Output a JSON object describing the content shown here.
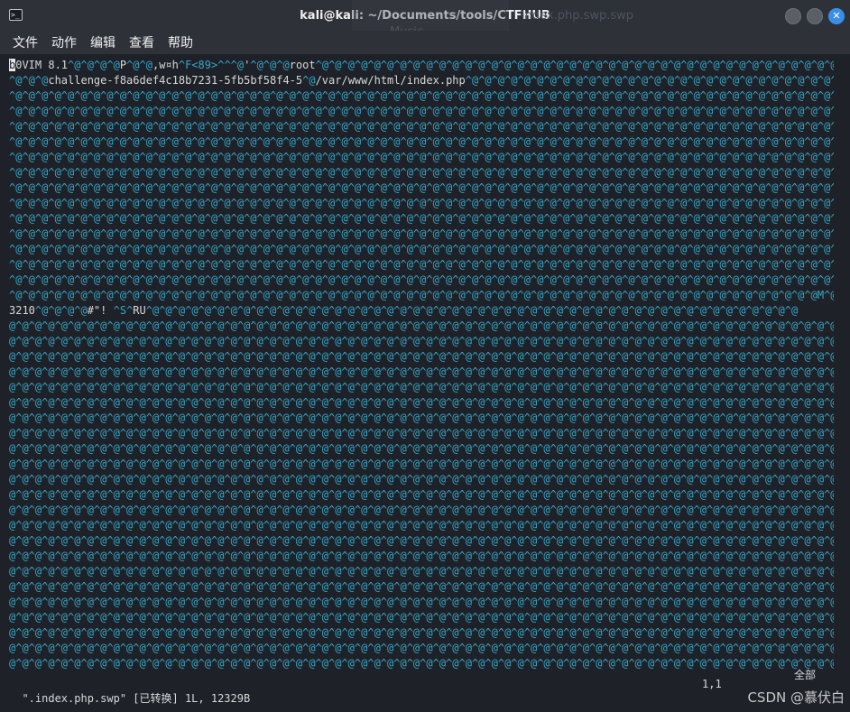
{
  "window": {
    "title": "kali@kali: ~/Documents/tools/CTFHUB",
    "terminal_icon_glyph": ">_",
    "close_glyph": "✕",
    "ghost_texts": [
      "index.php.swp.swp",
      "Music"
    ]
  },
  "menu": [
    "文件",
    "动作",
    "编辑",
    "查看",
    "帮助"
  ],
  "buffer": {
    "line1": {
      "cursor_char": "b",
      "segments": [
        {
          "t": "0VIM 8.1",
          "c": "w"
        },
        {
          "t": "^@^@^@^@",
          "c": "b"
        },
        {
          "t": "P",
          "c": "w"
        },
        {
          "t": "^@^@",
          "c": "b"
        },
        {
          "t": ",w¤h",
          "c": "w"
        },
        {
          "t": "^F<89>^^^@",
          "c": "b"
        },
        {
          "t": "'",
          "c": "w"
        },
        {
          "t": "^@^@^@",
          "c": "b"
        },
        {
          "t": "root",
          "c": "w"
        }
      ]
    },
    "line2": {
      "segments": [
        {
          "t": "^@^@^@",
          "c": "b"
        },
        {
          "t": "challenge-f8a6def4c18b7231-5fb5bf58f4-5",
          "c": "w"
        },
        {
          "t": "^@",
          "c": "b"
        },
        {
          "t": "/var/www/html/index.php",
          "c": "w"
        }
      ]
    },
    "line_b0": {
      "segments": [
        {
          "t": "^@^@^@^@^@^@^@^@^@^@^@^@^@^@^@^@^@^@^@^@^@^@^@^@^@^@^@^@^@^@^@^@^@^@^@^@^@^@^@^@^@^@^@^@^@^@^@^@^@^@^@^@^@^@^@^@^@^@^@^@^@^@",
          "c": "b"
        },
        {
          "t": "M",
          "c": "b"
        },
        {
          "t": "^@",
          "c": "b"
        }
      ]
    },
    "line_b1": {
      "segments": [
        {
          "t": "3210",
          "c": "w"
        },
        {
          "t": "^@^@^@^@",
          "c": "b"
        },
        {
          "t": "#\"!",
          "c": "w"
        },
        {
          "t": " ^S^",
          "c": "b"
        },
        {
          "t": "RU",
          "c": "w"
        },
        {
          "t": "^@^@^@^@^@^@^@^@^@^@^@^@^@^@^@^@^@^@^@^@^@^@^@^@^@^@^@^@^@^@^@^@^@^@^@^@^@^@^@^@^@^@^@^@^@^@^@^@^@^@",
          "c": "b"
        }
      ]
    },
    "fill_a": "^@^@^@^@^@^@^@^@^@^@^@^@^@^@^@^@^@^@^@^@^@^@^@^@^@^@^@^@^@^@^@^@^@^@^@^@^@^@^@^@^@^@^@^@^@^@^@^@^@^@^@^@^@^@^@^@^@^@^@^@^@^@^@^@^@^@^@^@^@^@",
    "fill_b": "@^@^@^@^@^@^@^@^@^@^@^@^@^@^@^@^@^@^@^@^@^@^@^@^@^@^@^@^@^@^@^@^@^@^@^@^@^@^@^@^@^@^@^@^@^@^@^@^@^@^@^@^@^@^@^@^@^@^@^@^@^@^@^@^@^@^@^@^@^@^"
  },
  "status": {
    "file_info": "\".index.php.swp\" [已转换] 1L, 12329B",
    "cursor_pos": "1,1",
    "scroll": "全部"
  },
  "watermark": "CSDN @慕伏白",
  "colors": {
    "background": "#1e2128",
    "control_chars": "#36a8c8",
    "text": "#d8d8d8",
    "close_button": "#3a8ee6"
  }
}
